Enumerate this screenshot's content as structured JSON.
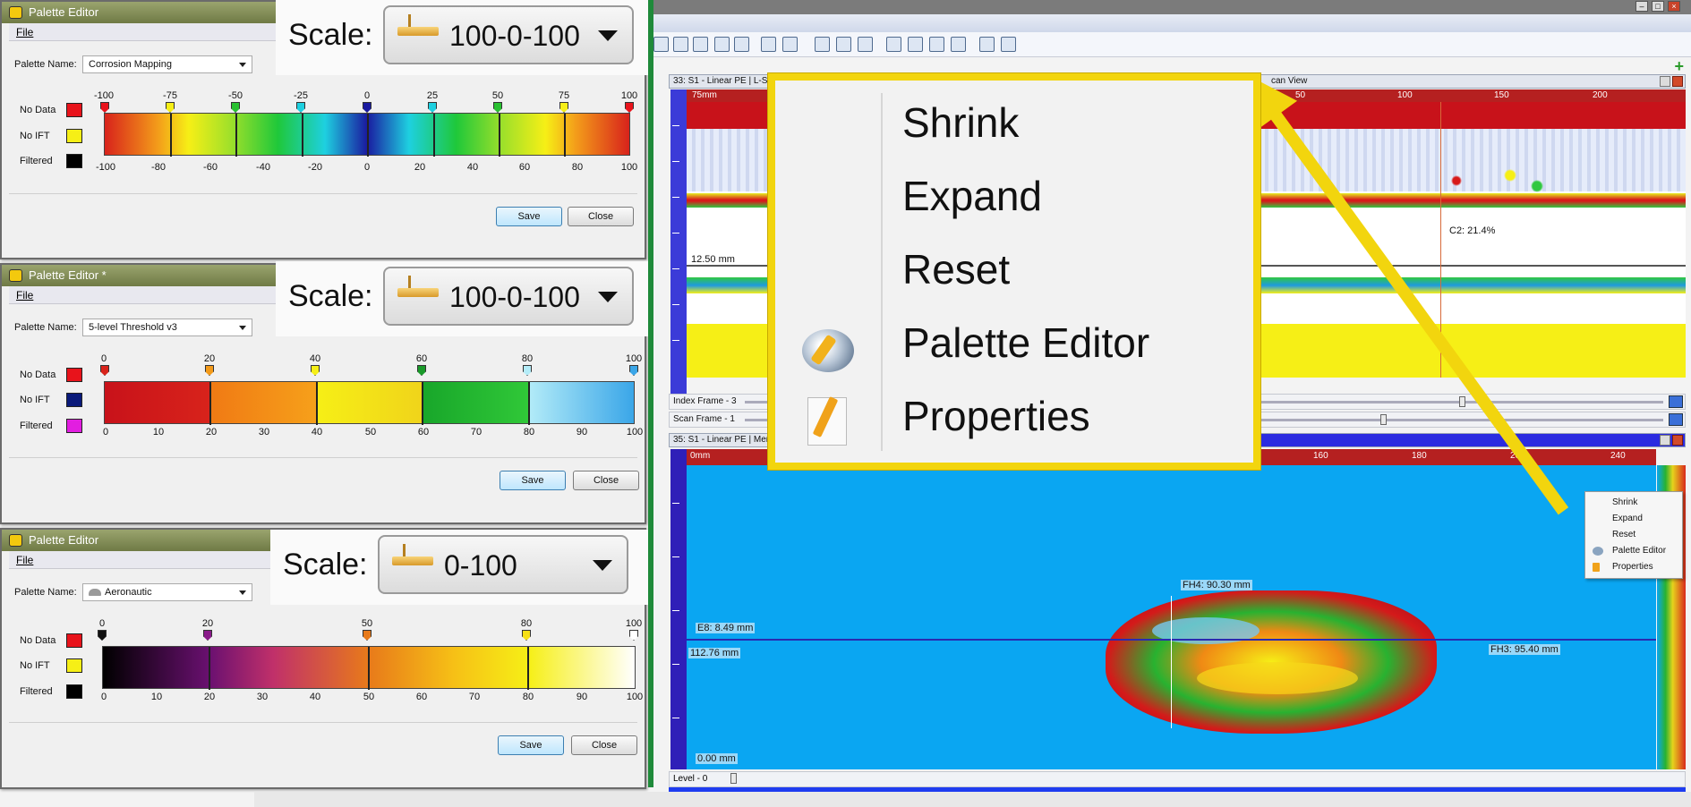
{
  "palette_editors": [
    {
      "title": "Palette Editor",
      "menu_file": "File",
      "name_label": "Palette Name:",
      "name_value": "Corrosion Mapping",
      "specials": [
        {
          "label": "No Data",
          "color": "#e8131b"
        },
        {
          "label": "No IFT",
          "color": "#f6ef16"
        },
        {
          "label": "Filtered",
          "color": "#000000"
        }
      ],
      "top_labels": [
        "-100",
        "-75",
        "-50",
        "-25",
        "0",
        "25",
        "50",
        "75",
        "100"
      ],
      "bottom_labels": [
        "-100",
        "-80",
        "-60",
        "-40",
        "-20",
        "0",
        "20",
        "40",
        "60",
        "80",
        "100"
      ],
      "save": "Save",
      "close": "Close",
      "scale_label": "Scale:",
      "scale_value": "100-0-100"
    },
    {
      "title": "Palette Editor *",
      "menu_file": "File",
      "name_label": "Palette Name:",
      "name_value": "5-level Threshold v3",
      "specials": [
        {
          "label": "No Data",
          "color": "#e8131b"
        },
        {
          "label": "No IFT",
          "color": "#0a1a7a"
        },
        {
          "label": "Filtered",
          "color": "#e21ee0"
        }
      ],
      "top_labels": [
        "0",
        "20",
        "40",
        "60",
        "80",
        "100"
      ],
      "bottom_labels": [
        "0",
        "10",
        "20",
        "30",
        "40",
        "50",
        "60",
        "70",
        "80",
        "90",
        "100"
      ],
      "save": "Save",
      "close": "Close",
      "scale_label": "Scale:",
      "scale_value": "100-0-100"
    },
    {
      "title": "Palette Editor",
      "menu_file": "File",
      "name_label": "Palette Name:",
      "name_value": "Aeronautic",
      "specials": [
        {
          "label": "No Data",
          "color": "#e8131b"
        },
        {
          "label": "No IFT",
          "color": "#f6ef16"
        },
        {
          "label": "Filtered",
          "color": "#000000"
        }
      ],
      "top_labels": [
        "0",
        "20",
        "50",
        "80",
        "100"
      ],
      "bottom_labels": [
        "0",
        "10",
        "20",
        "30",
        "40",
        "50",
        "60",
        "70",
        "80",
        "90",
        "100"
      ],
      "save": "Save",
      "close": "Close",
      "scale_label": "Scale:",
      "scale_value": "0-100"
    }
  ],
  "app": {
    "pane_top_title": "33: S1 - Linear PE | L-Scan",
    "pane_top_title_right": "can View",
    "pane_bottom_title": "35: S1 - Linear PE | Merged",
    "top_ruler_labels": [
      "75mm",
      "50",
      "100",
      "150",
      "200"
    ],
    "bottom_ruler_labels": [
      "0mm",
      "160",
      "180",
      "200",
      "240"
    ],
    "lscan_depth_label": "12.50 mm",
    "lscan_cursor_label": "C2: 21.4%",
    "index_frame": "Index Frame - 3",
    "scan_frame": "Scan Frame - 1",
    "level": "Level - 0",
    "measurements": {
      "fh4": "FH4: 90.30 mm",
      "e8": "E8: 8.49 mm",
      "fh3": "FH3: 95.40 mm",
      "depth1": "112.76 mm",
      "depth0": "0.00 mm"
    }
  },
  "context_menu": {
    "items": [
      "Shrink",
      "Expand",
      "Reset",
      "Palette Editor",
      "Properties"
    ]
  }
}
